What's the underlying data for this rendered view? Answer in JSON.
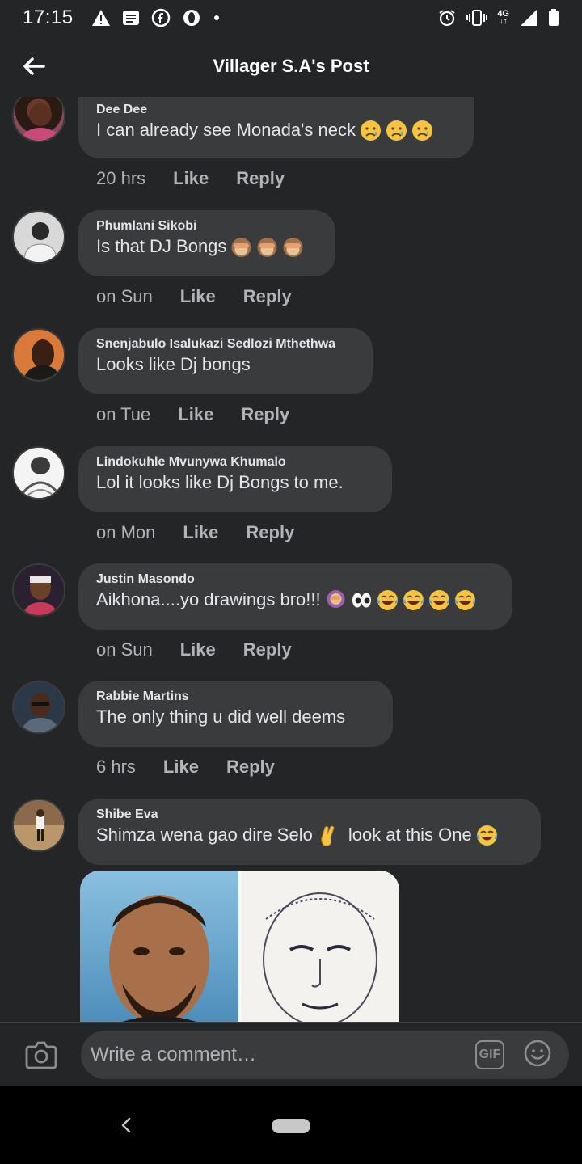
{
  "status_bar": {
    "time": "17:15",
    "network": "4G",
    "icons_left": [
      "warning-icon",
      "message-icon",
      "facebook-icon",
      "opera-icon",
      "dot-icon"
    ],
    "icons_right": [
      "alarm-icon",
      "vibrate-icon",
      "network-4g-icon",
      "signal-icon",
      "battery-icon"
    ]
  },
  "header": {
    "title": "Villager S.A's Post",
    "back_icon": "arrow-left-icon"
  },
  "comments": [
    {
      "author": "Dee Dee",
      "text": "I can already see Monada's neck",
      "emojis": [
        "sad-tear-emoji",
        "sad-tear-emoji",
        "sad-tear-emoji"
      ],
      "time": "20 hrs",
      "like": "Like",
      "reply": "Reply"
    },
    {
      "author": "Phumlani Sikobi",
      "text": "Is that DJ Bongs",
      "emojis": [
        "see-no-evil-monkey-emoji",
        "see-no-evil-monkey-emoji",
        "see-no-evil-monkey-emoji"
      ],
      "time": "on Sun",
      "like": "Like",
      "reply": "Reply"
    },
    {
      "author": "Snenjabulo Isalukazi Sedlozi Mthethwa",
      "text": "Looks like Dj bongs",
      "emojis": [],
      "time": "on Tue",
      "like": "Like",
      "reply": "Reply"
    },
    {
      "author": "Lindokuhle Mvunywa Khumalo",
      "text": "Lol it looks like Dj Bongs to me.",
      "emojis": [],
      "time": "on Mon",
      "like": "Like",
      "reply": "Reply"
    },
    {
      "author": "Justin Masondo",
      "text": "Aikhona....yo drawings bro!!!",
      "emojis": [
        "woman-facepalm-emoji",
        "eyes-emoji",
        "tears-of-joy-emoji",
        "tears-of-joy-emoji",
        "tears-of-joy-emoji",
        "tears-of-joy-emoji"
      ],
      "time": "on Sun",
      "like": "Like",
      "reply": "Reply"
    },
    {
      "author": "Rabbie Martins",
      "text": "The only thing u did well deems",
      "emojis": [],
      "time": "6 hrs",
      "like": "Like",
      "reply": "Reply"
    },
    {
      "author": "Shibe Eva",
      "text_before": "Shimza wena gao dire Selo",
      "text_after": "look at this One",
      "emojis": [
        "crossed-fingers-emoji",
        "tears-of-joy-emoji"
      ],
      "has_photo": true
    }
  ],
  "composer": {
    "placeholder": "Write a comment…",
    "gif_label": "GIF",
    "camera_icon": "camera-icon",
    "emoji_icon": "smiley-icon"
  },
  "nav": {
    "back_icon": "nav-back-icon",
    "home_icon": "home-pill-icon"
  },
  "colors": {
    "background": "#242526",
    "bubble": "#3a3b3c",
    "primary_text": "#e4e6eb",
    "secondary_text": "#b0b3b8"
  }
}
